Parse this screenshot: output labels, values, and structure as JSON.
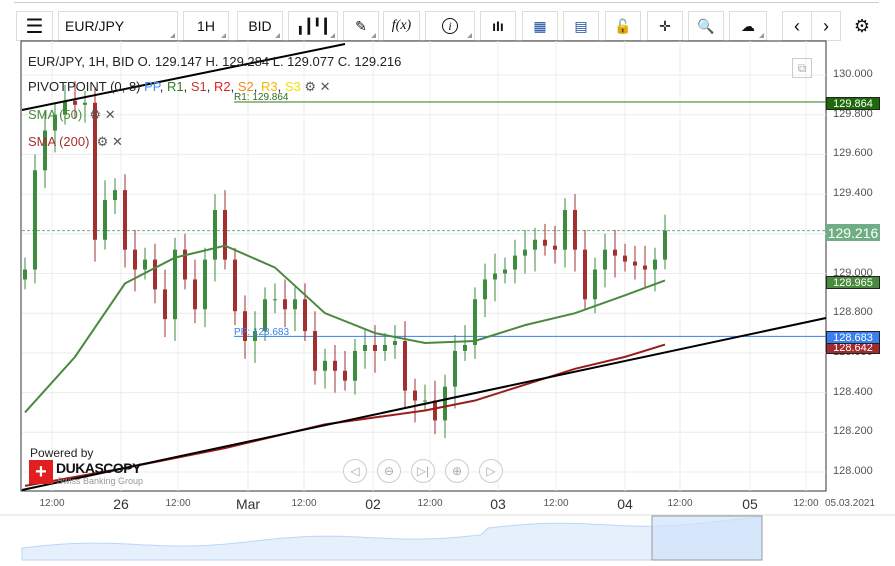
{
  "toolbar": {
    "menu_icon": "hamburger-icon",
    "symbol": "EUR/JPY",
    "timeframe": "1H",
    "side": "BID",
    "chart_type_icon": "candlestick-icon",
    "draw_icon": "pencil-icon",
    "indicator_label": "f(x)",
    "info_icon": "info-icon",
    "bars_icon": "bar-chart-icon",
    "calendar_icon": "calendar-icon",
    "news_icon": "news-icon",
    "lock_icon": "unlock-icon",
    "crosshair_icon": "crosshair-icon",
    "zoom_icon": "zoom-chart-icon",
    "upload_icon": "cloud-upload-icon",
    "prev_icon": "chevron-left-icon",
    "next_icon": "chevron-right-icon",
    "settings_icon": "gear-icon"
  },
  "legend": {
    "ohlc": "EUR/JPY, 1H, BID   O. 129.147 H. 129.284 L. 129.077 C. 129.216",
    "pivot": {
      "name": "PIVOTPOINT (0, 8)",
      "items": [
        {
          "label": "PP",
          "color": "#3a8ef6"
        },
        {
          "label": "R1",
          "color": "#2e7d1f"
        },
        {
          "label": "S1",
          "color": "#c0392b"
        },
        {
          "label": "R2",
          "color": "#e81e1e"
        },
        {
          "label": "S2",
          "color": "#f28c18"
        },
        {
          "label": "R3",
          "color": "#f5b800"
        },
        {
          "label": "S3",
          "color": "#f0e000"
        }
      ]
    },
    "sma50": "SMA (50)",
    "sma200": "SMA (200)"
  },
  "colors": {
    "up": "#3d8b3d",
    "down": "#a33030",
    "sma50": "#4a8a3f",
    "sma200": "#9b1c1c",
    "pp": "#3a7ef0",
    "r1": "#4f8a2e",
    "trend": "#000000"
  },
  "levels": {
    "r1_label": "R1: 129.864",
    "pp_label": "PP: 128.683",
    "r1": 129.864,
    "pp": 128.683,
    "current": 129.216,
    "sma50": 128.965,
    "sma200": 128.642,
    "r1_text": "129.864",
    "current_text": "129.216",
    "sma50_text": "128.965",
    "pp_text": "128.683",
    "sma200_text": "128.642"
  },
  "price_axis": [
    "130.000",
    "129.800",
    "129.600",
    "129.400",
    "129.200",
    "129.000",
    "128.800",
    "128.600",
    "128.400",
    "128.200",
    "128.000"
  ],
  "time_axis": [
    "12:00",
    "26",
    "12:00",
    "Mar",
    "12:00",
    "02",
    "12:00",
    "03",
    "12:00",
    "04",
    "12:00",
    "05",
    "12:00",
    "05.03.2021"
  ],
  "branding": {
    "powered": "Powered by",
    "logo": "DUKASCOPY",
    "tagline": "Swiss Banking Group"
  },
  "nav_buttons": [
    {
      "name": "scroll-left",
      "glyph": "◁"
    },
    {
      "name": "zoom-out",
      "glyph": "⊖"
    },
    {
      "name": "go-to-end",
      "glyph": "▷|"
    },
    {
      "name": "zoom-in",
      "glyph": "⊕"
    },
    {
      "name": "scroll-right",
      "glyph": "▷"
    }
  ],
  "chart_data": {
    "type": "candlestick",
    "symbol": "EUR/JPY",
    "ylim": [
      127.9,
      130.15
    ],
    "closes": [
      129.02,
      129.52,
      129.72,
      129.8,
      129.87,
      129.85,
      129.86,
      129.17,
      129.37,
      129.42,
      129.12,
      129.02,
      129.07,
      128.92,
      128.77,
      129.12,
      128.97,
      128.82,
      129.07,
      129.32,
      129.07,
      128.81,
      128.66,
      128.71,
      128.87,
      128.87,
      128.82,
      128.87,
      128.71,
      128.51,
      128.56,
      128.51,
      128.46,
      128.61,
      128.64,
      128.61,
      128.64,
      128.66,
      128.41,
      128.36,
      128.36,
      128.26,
      128.43,
      128.61,
      128.64,
      128.87,
      128.97,
      129.0,
      129.02,
      129.09,
      129.12,
      129.17,
      129.14,
      129.12,
      129.32,
      129.12,
      128.87,
      129.02,
      129.12,
      129.09,
      129.06,
      129.04,
      129.02,
      129.07,
      129.216
    ],
    "sma50": [
      [
        0,
        128.3
      ],
      [
        5,
        128.58
      ],
      [
        10,
        128.95
      ],
      [
        15,
        129.08
      ],
      [
        20,
        129.14
      ],
      [
        25,
        129.03
      ],
      [
        30,
        128.8
      ],
      [
        35,
        128.7
      ],
      [
        40,
        128.65
      ],
      [
        45,
        128.66
      ],
      [
        50,
        128.74
      ],
      [
        55,
        128.8
      ],
      [
        60,
        128.89
      ],
      [
        64,
        128.965
      ]
    ],
    "sma200": [
      [
        0,
        127.93
      ],
      [
        10,
        128.02
      ],
      [
        20,
        128.12
      ],
      [
        30,
        128.24
      ],
      [
        40,
        128.31
      ],
      [
        45,
        128.36
      ],
      [
        50,
        128.44
      ],
      [
        55,
        128.52
      ],
      [
        60,
        128.58
      ],
      [
        64,
        128.642
      ]
    ]
  }
}
